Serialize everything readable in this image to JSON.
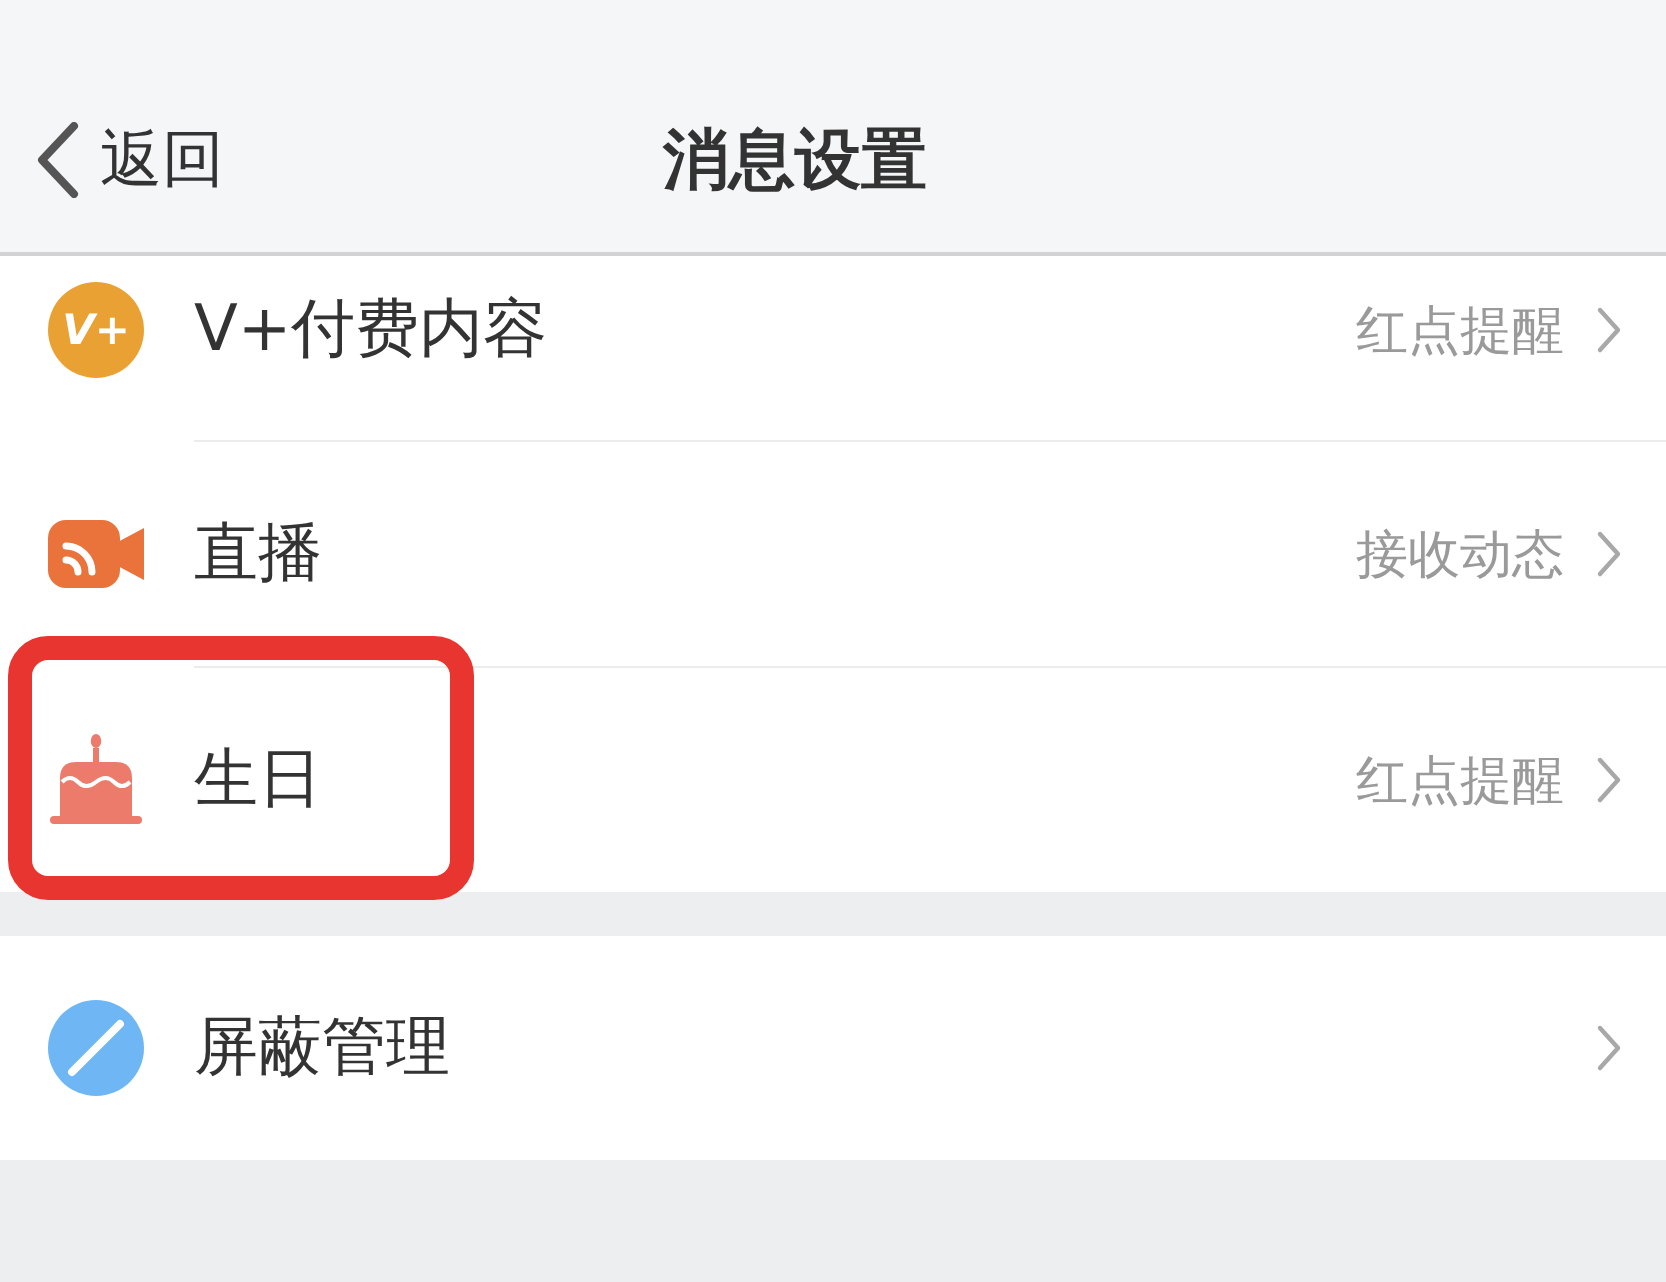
{
  "nav_bar": {
    "back_button": "返回",
    "title": "消息设置"
  },
  "sections": [
    {
      "items": [
        {
          "kind": "vplus",
          "icon_text": "V+",
          "label": "V+付费内容",
          "value": "红点提醒",
          "highlighted": false
        },
        {
          "kind": "live",
          "label": "直播",
          "value": "接收动态",
          "highlighted": false
        },
        {
          "kind": "birthday",
          "label": "生日",
          "value": "红点提醒",
          "highlighted": true
        }
      ]
    },
    {
      "items": [
        {
          "kind": "block",
          "label": "屏蔽管理",
          "highlighted": false
        }
      ]
    }
  ]
}
